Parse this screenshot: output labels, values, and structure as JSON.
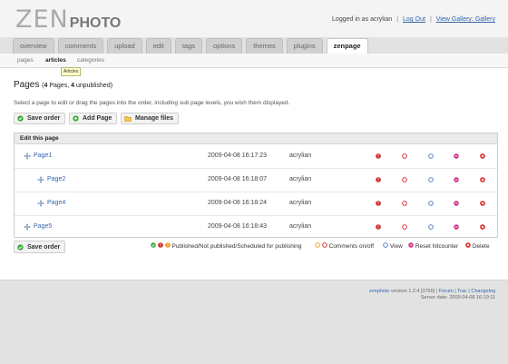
{
  "header": {
    "logo_zen": "ZEN",
    "logo_photo": "PHOTO",
    "logged_in_text": "Logged in as acrylian",
    "logout_label": "Log Out",
    "gallery_label": "View Gallery: Gallery"
  },
  "tabs": [
    {
      "label": "overview"
    },
    {
      "label": "comments"
    },
    {
      "label": "upload"
    },
    {
      "label": "edit"
    },
    {
      "label": "tags"
    },
    {
      "label": "options"
    },
    {
      "label": "themes"
    },
    {
      "label": "plugins"
    },
    {
      "label": "zenpage",
      "active": true
    }
  ],
  "subtabs": [
    {
      "label": "pages"
    },
    {
      "label": "articles",
      "active": true
    },
    {
      "label": "categories"
    }
  ],
  "tooltip": "Articles",
  "main": {
    "title": "Pages",
    "count_open": "(",
    "count_pages": "4",
    "count_pages_label": "Pages,",
    "count_unpub": "4",
    "count_unpub_label": "unpublished)",
    "instructions": "Select a page to edit or drag the pages into the order, including sub page levels, you wish them displayed.",
    "save_label": "Save order",
    "add_label": "Add Page",
    "manage_label": "Manage files",
    "panel_title": "Edit this page"
  },
  "pages": [
    {
      "name": "Page1",
      "date": "2009-04-08 16:17:23",
      "author": "acrylian",
      "level": 0
    },
    {
      "name": "Page2",
      "date": "2009-04-08 16:18:07",
      "author": "acrylian",
      "level": 1
    },
    {
      "name": "Page4",
      "date": "2009-04-08 16:18:24",
      "author": "acrylian",
      "level": 1
    },
    {
      "name": "Page5",
      "date": "2009-04-08 16:18:43",
      "author": "acrylian",
      "level": 0
    }
  ],
  "legend": {
    "publish": "Published/Not published/Scheduled for publishing",
    "comments": "Comments on/off",
    "view": "View",
    "reset": "Reset hitcounter",
    "delete": "Delete"
  },
  "colors": {
    "green": "#3aa635",
    "red": "#d52020",
    "orange": "#e59a22",
    "blue": "#4a78c8",
    "pink": "#d0308c"
  },
  "footer": {
    "brand": "zenphoto",
    "version": "version 1.2.4 [3765] |",
    "forum": "Forum",
    "trac": "Trac",
    "changelog": "Changelog",
    "server_date": "Server date: 2009-04-08 16:19:11"
  }
}
